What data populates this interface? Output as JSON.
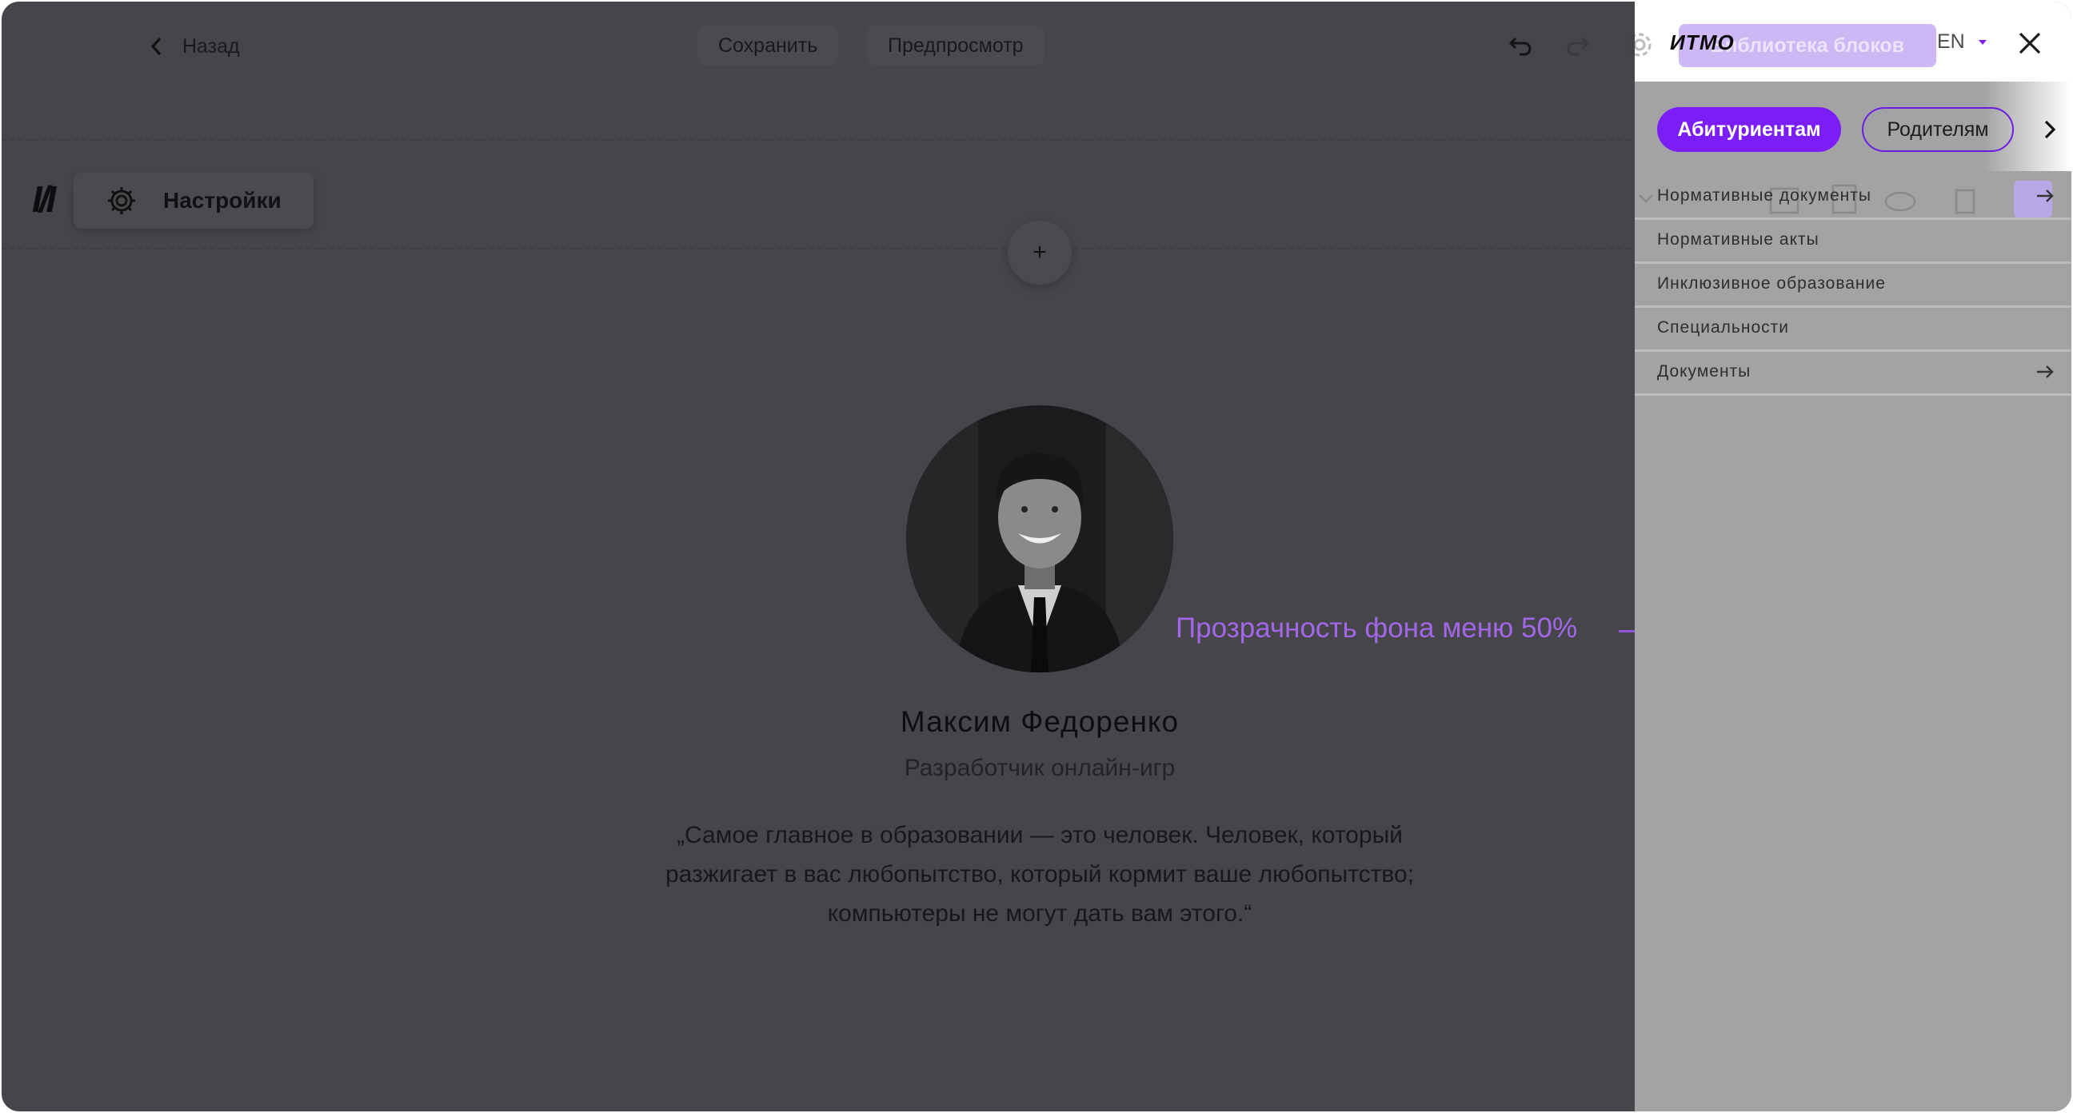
{
  "toolbar": {
    "back_label": "Назад",
    "save_label": "Сохранить",
    "preview_label": "Предпросмотр"
  },
  "settings": {
    "logo_text": "Ӏ/Ӏ",
    "label": "Настройки"
  },
  "profile": {
    "name": "Максим Федоренко",
    "role": "Разработчик онлайн-игр",
    "quote_line1": "„Самое главное в образовании — это человек. Человек, который",
    "quote_line2": "разжигает в вас любопытство, который кормит ваше любопытство;",
    "quote_line3": "компьютеры не могут дать вам этого.“"
  },
  "annotation": {
    "text": "Прозрачность фона меню 50%"
  },
  "menu_panel": {
    "logo": "ИТМО",
    "library_button": "Библиотека блоков",
    "language": "EN",
    "tabs": [
      {
        "label": "Абитуриентам"
      },
      {
        "label": "Родителям"
      }
    ],
    "items": [
      {
        "label": "Нормативные документы"
      },
      {
        "label": "Нормативные акты"
      },
      {
        "label": "Инклюзивное образование"
      },
      {
        "label": "Специальности"
      },
      {
        "label": "Документы"
      }
    ]
  },
  "colors": {
    "accent": "#7a1ef5",
    "annotation": "#a267e8",
    "overlay": "#46464a"
  }
}
